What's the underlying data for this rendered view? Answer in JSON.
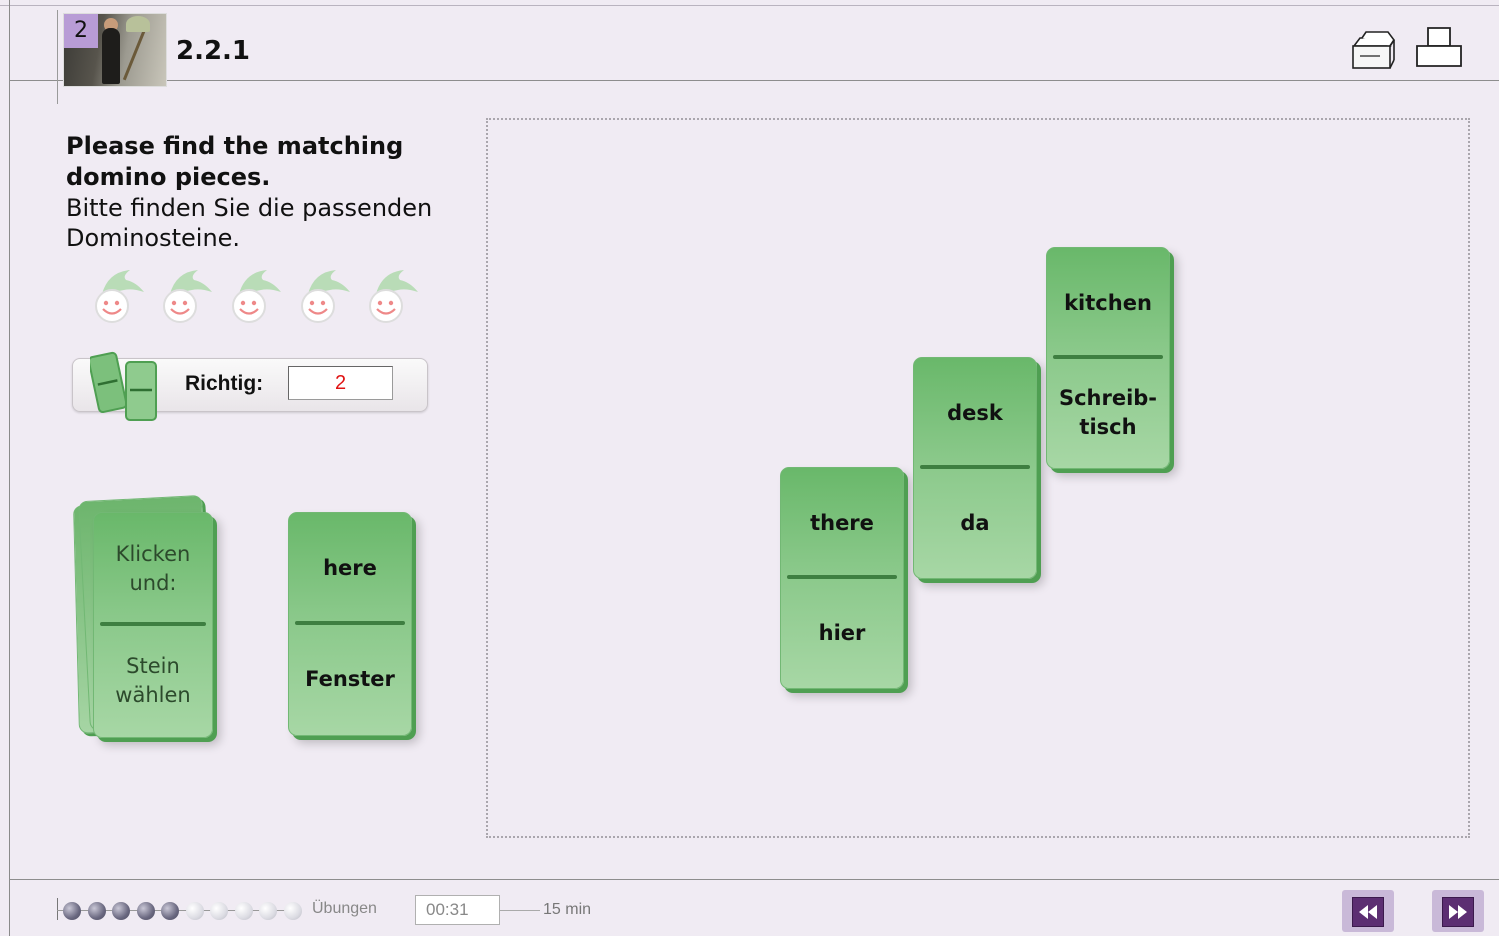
{
  "header": {
    "chapter": "2",
    "lesson": "2.2.1",
    "icons": [
      "folder-stack-icon",
      "print-icon"
    ]
  },
  "instructions": {
    "english": "Please find the matching domino pieces.",
    "german": "Bitte finden Sie die passenden Dominosteine."
  },
  "lives": {
    "icon": "jester-smiley-icon",
    "count": 5
  },
  "score": {
    "label": "Richtig:",
    "value": "2"
  },
  "deck": {
    "top": "Klicken und:",
    "bottom": "Stein wählen"
  },
  "hand_tile": {
    "top": "here",
    "bottom": "Fenster"
  },
  "board_tiles": [
    {
      "top": "there",
      "bottom": "hier"
    },
    {
      "top": "desk",
      "bottom": "da"
    },
    {
      "top": "kitchen",
      "bottom": "Schreib-tisch"
    }
  ],
  "footer": {
    "progress_done": 5,
    "progress_total": 10,
    "progress_label": "Übungen",
    "timer": "00:31",
    "time_limit": "15 min"
  },
  "nav": {
    "back_icon": "rewind-icon",
    "forward_icon": "fast-forward-icon"
  },
  "colors": {
    "background": "#f0ebf3",
    "tile_green": "#89c889",
    "nav_purple": "#5c2e72",
    "score_red": "#e01414"
  }
}
